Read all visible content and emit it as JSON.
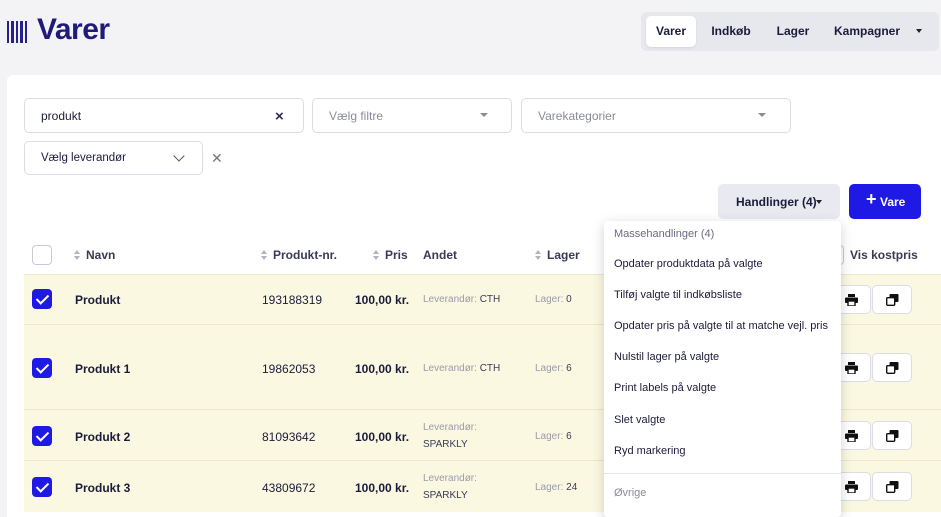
{
  "header": {
    "title": "Varer",
    "nav": [
      "Varer",
      "Indkøb",
      "Lager",
      "Kampagner"
    ],
    "nav_active": "Varer"
  },
  "filters": {
    "search_value": "produkt",
    "filter_placeholder": "Vælg filtre",
    "category_placeholder": "Varekategorier",
    "supplier_placeholder": "Vælg leverandør"
  },
  "toolbar": {
    "actions_label": "Handlinger (4)",
    "add_label": "Vare"
  },
  "table": {
    "columns": [
      "Navn",
      "Produkt-nr.",
      "Pris",
      "Andet",
      "Lager"
    ],
    "cost_toggle_label": "Vis kostpris",
    "supplier_prefix": "Leverandør:",
    "stock_prefix": "Lager:",
    "rows": [
      {
        "name": "Produkt",
        "number": "193188319",
        "price": "100,00 kr.",
        "supplier": "CTH",
        "stock": "0",
        "selected": true
      },
      {
        "name": "Produkt 1",
        "number": "19862053",
        "price": "100,00 kr.",
        "supplier": "CTH",
        "stock": "6",
        "selected": true
      },
      {
        "name": "Produkt 2",
        "number": "81093642",
        "price": "100,00 kr.",
        "supplier": "SPARKLY",
        "stock": "6",
        "selected": true
      },
      {
        "name": "Produkt 3",
        "number": "43809672",
        "price": "100,00 kr.",
        "supplier": "SPARKLY",
        "stock": "24",
        "selected": true
      }
    ]
  },
  "dropdown": {
    "title": "Massehandlinger (4)",
    "items": [
      "Opdater produktdata på valgte",
      "Tilføj valgte til indkøbsliste",
      "Opdater pris på valgte til at matche vejl. pris",
      "Nulstil lager på valgte",
      "Print labels på valgte",
      "Slet valgte",
      "Ryd markering"
    ],
    "other_label": "Øvrige"
  },
  "colors": {
    "brand": "#1f1b78",
    "primary_button": "#1f19e6",
    "selected_row": "#fbf8e1"
  },
  "icons": [
    "barcode-logo",
    "clear-icon",
    "chevron-down-icon",
    "plus-icon",
    "sort-icon",
    "print-icon",
    "duplicate-icon"
  ]
}
